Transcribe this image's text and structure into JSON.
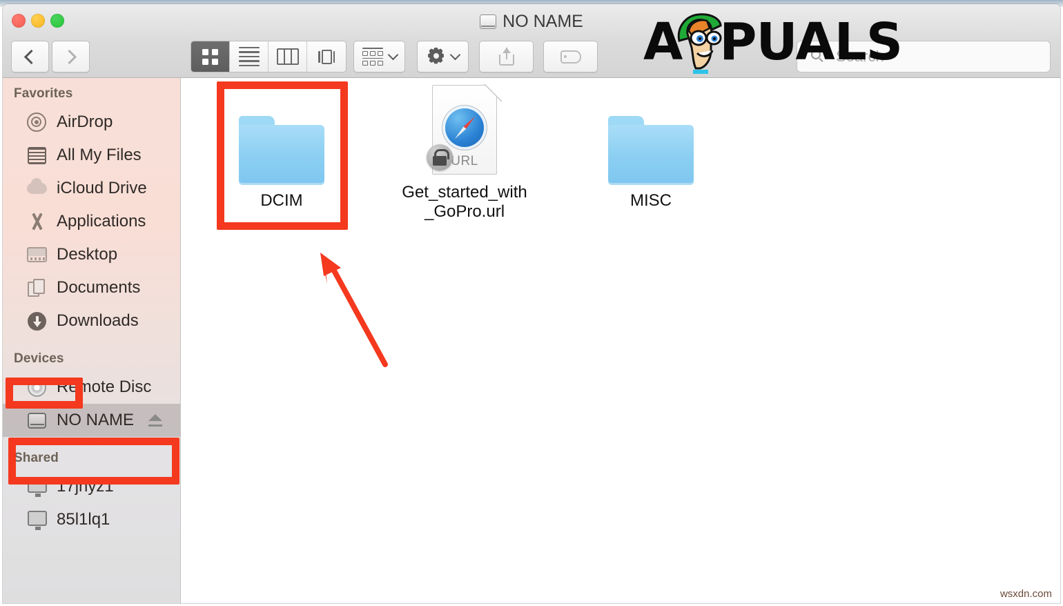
{
  "window": {
    "title": "NO NAME",
    "title_icon": "hard-drive-icon",
    "traffic_lights": [
      "close-button",
      "minimize-button",
      "zoom-button"
    ]
  },
  "toolbar": {
    "back_label": "‹",
    "forward_label": "›",
    "view_modes": [
      {
        "name": "icon-view",
        "icon": "grid-icon",
        "active": true
      },
      {
        "name": "list-view",
        "icon": "list-icon",
        "active": false
      },
      {
        "name": "column-view",
        "icon": "columns-icon",
        "active": false
      },
      {
        "name": "coverflow-view",
        "icon": "coverflow-icon",
        "active": false
      }
    ],
    "arrange_label": "arrange-by",
    "action_label": "action-gear",
    "share_label": "share",
    "tags_label": "tags"
  },
  "search": {
    "placeholder": "Search"
  },
  "sidebar": {
    "sections": [
      {
        "header": "Favorites",
        "items": [
          {
            "label": "AirDrop",
            "icon": "airdrop-icon",
            "selected": false
          },
          {
            "label": "All My Files",
            "icon": "all-my-files-icon",
            "selected": false
          },
          {
            "label": "iCloud Drive",
            "icon": "icloud-icon",
            "selected": false
          },
          {
            "label": "Applications",
            "icon": "applications-icon",
            "selected": false
          },
          {
            "label": "Desktop",
            "icon": "desktop-icon",
            "selected": false
          },
          {
            "label": "Documents",
            "icon": "documents-icon",
            "selected": false
          },
          {
            "label": "Downloads",
            "icon": "downloads-icon",
            "selected": false
          }
        ]
      },
      {
        "header": "Devices",
        "items": [
          {
            "label": "Remote Disc",
            "icon": "remote-disc-icon",
            "selected": false
          },
          {
            "label": "NO NAME",
            "icon": "hard-drive-icon",
            "selected": true,
            "eject": true
          }
        ]
      },
      {
        "header": "Shared",
        "items": [
          {
            "label": "17jnyz1",
            "icon": "computer-icon",
            "selected": false
          },
          {
            "label": "85l1lq1",
            "icon": "computer-icon",
            "selected": false
          }
        ]
      }
    ]
  },
  "content": {
    "items": [
      {
        "name": "DCIM",
        "kind": "folder",
        "highlighted": true
      },
      {
        "name": "Get_started_with_GoPro.url",
        "kind": "url-file",
        "badge": "URL",
        "locked": true,
        "highlighted": false
      },
      {
        "name": "MISC",
        "kind": "folder",
        "highlighted": false
      }
    ]
  },
  "annotations": {
    "color": "#f4391f",
    "boxes": [
      "dcim-item",
      "devices-header",
      "no-name-device"
    ],
    "arrow": "points-to-dcim-folder"
  },
  "watermarks": {
    "brand_left": "A",
    "brand_right": "PUALS",
    "corner": "wsxdn.com"
  }
}
